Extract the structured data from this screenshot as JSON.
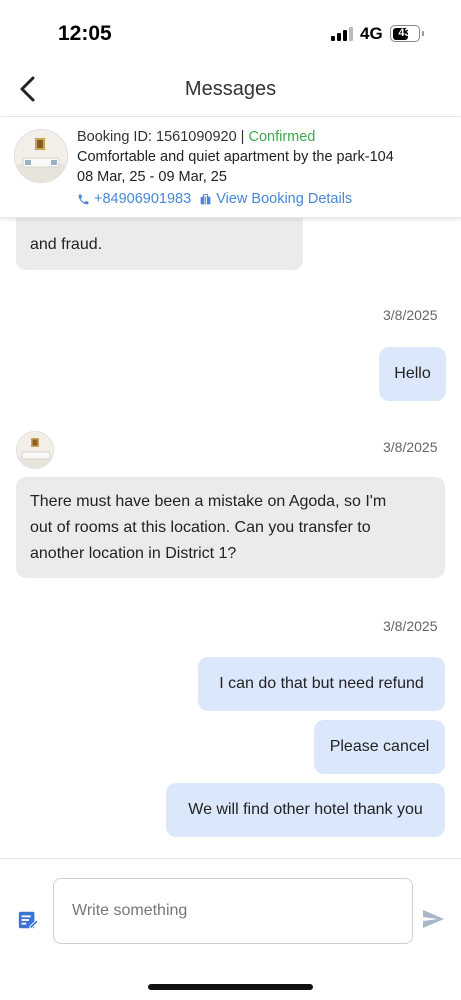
{
  "status_bar": {
    "time": "12:05",
    "network": "4G",
    "battery": "43"
  },
  "header": {
    "title": "Messages",
    "back_icon": "chevron-left-icon"
  },
  "booking": {
    "id_label": "Booking ID: ",
    "id": "1561090920",
    "separator": " | ",
    "status": "Confirmed",
    "status_color": "#3ea94b",
    "property_name": "Comfortable and quiet apartment by the park-104",
    "dates": "08 Mar, 25 - 09 Mar, 25",
    "phone": "+84906901983",
    "details_link": "View Booking Details",
    "link_color": "#4a86d6"
  },
  "chat": {
    "partial_message": "and fraud.",
    "messages": [
      {
        "direction": "out",
        "timestamp": "3/8/2025",
        "text": "Hello"
      },
      {
        "direction": "in",
        "timestamp": "3/8/2025",
        "lines": [
          "There must have been a mistake on Agoda, so I'm",
          "out of rooms at this location. Can you transfer to",
          "another location in District 1?"
        ]
      },
      {
        "direction": "out",
        "timestamp": "3/8/2025",
        "text": "I can do that but need refund"
      },
      {
        "direction": "out",
        "text": "Please cancel"
      },
      {
        "direction": "out",
        "text": "We will find other hotel thank you"
      }
    ],
    "incoming_color": "#ebebed",
    "outgoing_color": "#dbe8fb"
  },
  "composer": {
    "placeholder": "Write something",
    "value": "",
    "compose_icon": "edit-note-icon",
    "send_icon": "send-icon"
  }
}
